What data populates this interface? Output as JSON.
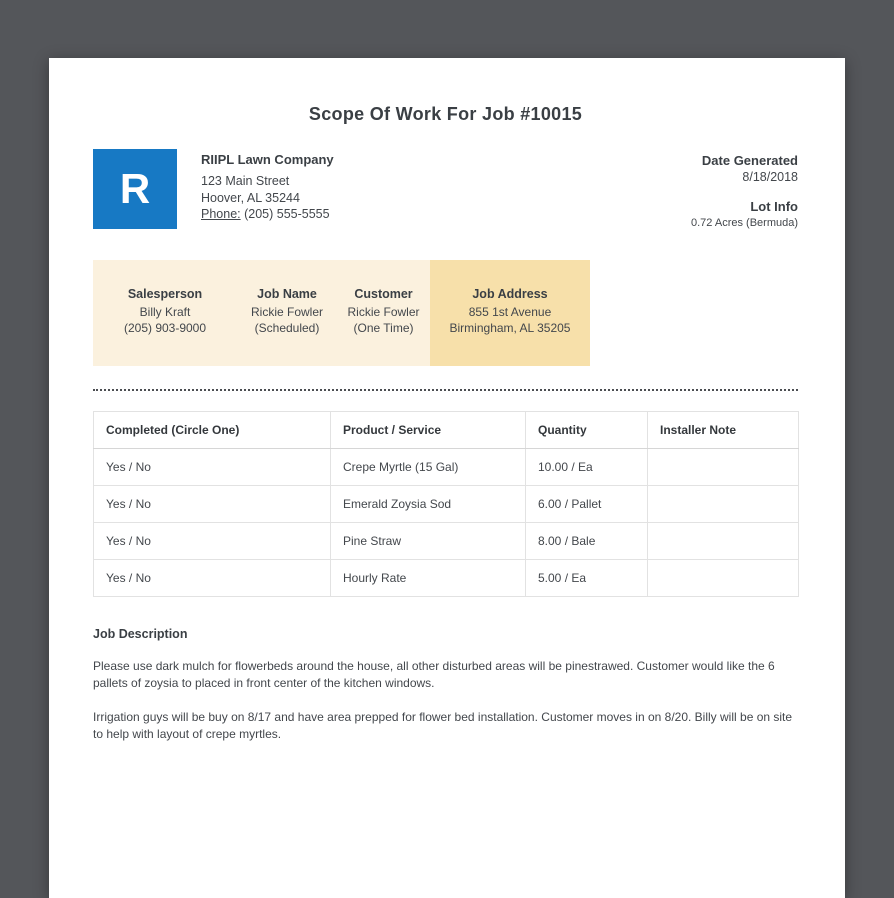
{
  "doc": {
    "title": "Scope Of Work For Job #10015"
  },
  "company": {
    "logo_letter": "R",
    "name": "RIIPL Lawn Company",
    "address_line1": "123 Main Street",
    "address_line2": "Hoover, AL 35244",
    "phone_label": "Phone:",
    "phone_value": "(205) 555-5555"
  },
  "meta": {
    "date_generated_label": "Date Generated",
    "date_generated_value": "8/18/2018",
    "lot_info_label": "Lot Info",
    "lot_info_value": "0.72 Acres (Bermuda)"
  },
  "job_info": {
    "columns": [
      {
        "label": "Salesperson",
        "line1": "Billy Kraft",
        "line2": "(205) 903-9000"
      },
      {
        "label": "Job Name",
        "line1": "Rickie Fowler",
        "line2": "(Scheduled)"
      },
      {
        "label": "Customer",
        "line1": "Rickie Fowler",
        "line2": "(One Time)"
      },
      {
        "label": "Job Address",
        "line1": "855 1st Avenue",
        "line2": "Birmingham, AL 35205"
      }
    ]
  },
  "work_table": {
    "headers": [
      "Completed (Circle One)",
      "Product / Service",
      "Quantity",
      "Installer Note"
    ],
    "rows": [
      [
        "Yes / No",
        "Crepe Myrtle (15 Gal)",
        "10.00 / Ea",
        ""
      ],
      [
        "Yes / No",
        "Emerald Zoysia Sod",
        "6.00 / Pallet",
        ""
      ],
      [
        "Yes / No",
        "Pine Straw",
        "8.00 / Bale",
        ""
      ],
      [
        "Yes / No",
        "Hourly Rate",
        "5.00 / Ea",
        ""
      ]
    ]
  },
  "job_description": {
    "heading": "Job Description",
    "paragraphs": [
      "Please use dark mulch for flowerbeds around the house, all other disturbed areas will be pinestrawed. Customer would like the 6 pallets of zoysia to placed in front center of the kitchen windows.",
      "Irrigation guys will be buy on 8/17 and have area prepped for flower bed installation. Customer moves in on 8/20. Billy will be on site to help with layout of crepe myrtles."
    ]
  },
  "colors": {
    "accent_blue": "#1779c4",
    "band_bg": "#fbf1de",
    "band_highlight": "#f7e0aa"
  }
}
